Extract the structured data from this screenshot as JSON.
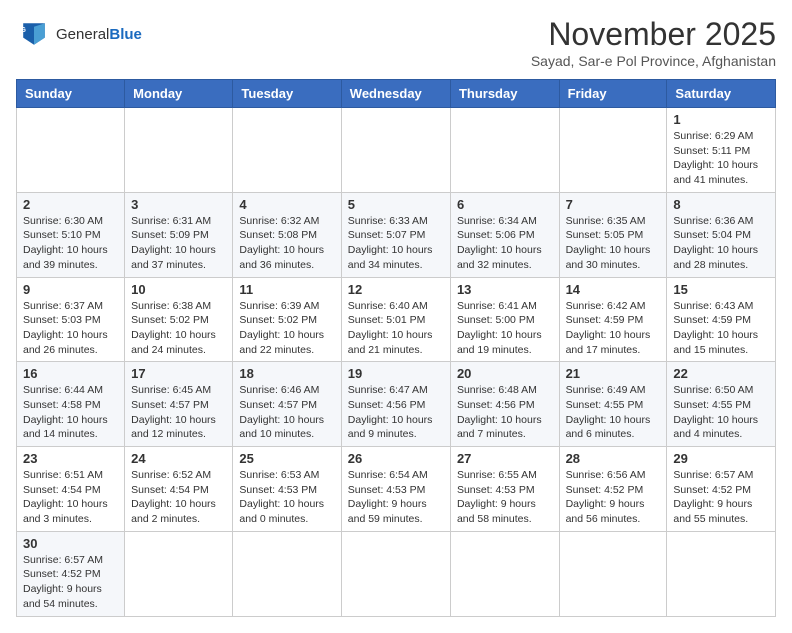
{
  "header": {
    "logo_text_general": "General",
    "logo_text_blue": "Blue",
    "month_title": "November 2025",
    "subtitle": "Sayad, Sar-e Pol Province, Afghanistan"
  },
  "days_of_week": [
    "Sunday",
    "Monday",
    "Tuesday",
    "Wednesday",
    "Thursday",
    "Friday",
    "Saturday"
  ],
  "weeks": [
    [
      {
        "num": "",
        "info": ""
      },
      {
        "num": "",
        "info": ""
      },
      {
        "num": "",
        "info": ""
      },
      {
        "num": "",
        "info": ""
      },
      {
        "num": "",
        "info": ""
      },
      {
        "num": "",
        "info": ""
      },
      {
        "num": "1",
        "info": "Sunrise: 6:29 AM\nSunset: 5:11 PM\nDaylight: 10 hours and 41 minutes."
      }
    ],
    [
      {
        "num": "2",
        "info": "Sunrise: 6:30 AM\nSunset: 5:10 PM\nDaylight: 10 hours and 39 minutes."
      },
      {
        "num": "3",
        "info": "Sunrise: 6:31 AM\nSunset: 5:09 PM\nDaylight: 10 hours and 37 minutes."
      },
      {
        "num": "4",
        "info": "Sunrise: 6:32 AM\nSunset: 5:08 PM\nDaylight: 10 hours and 36 minutes."
      },
      {
        "num": "5",
        "info": "Sunrise: 6:33 AM\nSunset: 5:07 PM\nDaylight: 10 hours and 34 minutes."
      },
      {
        "num": "6",
        "info": "Sunrise: 6:34 AM\nSunset: 5:06 PM\nDaylight: 10 hours and 32 minutes."
      },
      {
        "num": "7",
        "info": "Sunrise: 6:35 AM\nSunset: 5:05 PM\nDaylight: 10 hours and 30 minutes."
      },
      {
        "num": "8",
        "info": "Sunrise: 6:36 AM\nSunset: 5:04 PM\nDaylight: 10 hours and 28 minutes."
      }
    ],
    [
      {
        "num": "9",
        "info": "Sunrise: 6:37 AM\nSunset: 5:03 PM\nDaylight: 10 hours and 26 minutes."
      },
      {
        "num": "10",
        "info": "Sunrise: 6:38 AM\nSunset: 5:02 PM\nDaylight: 10 hours and 24 minutes."
      },
      {
        "num": "11",
        "info": "Sunrise: 6:39 AM\nSunset: 5:02 PM\nDaylight: 10 hours and 22 minutes."
      },
      {
        "num": "12",
        "info": "Sunrise: 6:40 AM\nSunset: 5:01 PM\nDaylight: 10 hours and 21 minutes."
      },
      {
        "num": "13",
        "info": "Sunrise: 6:41 AM\nSunset: 5:00 PM\nDaylight: 10 hours and 19 minutes."
      },
      {
        "num": "14",
        "info": "Sunrise: 6:42 AM\nSunset: 4:59 PM\nDaylight: 10 hours and 17 minutes."
      },
      {
        "num": "15",
        "info": "Sunrise: 6:43 AM\nSunset: 4:59 PM\nDaylight: 10 hours and 15 minutes."
      }
    ],
    [
      {
        "num": "16",
        "info": "Sunrise: 6:44 AM\nSunset: 4:58 PM\nDaylight: 10 hours and 14 minutes."
      },
      {
        "num": "17",
        "info": "Sunrise: 6:45 AM\nSunset: 4:57 PM\nDaylight: 10 hours and 12 minutes."
      },
      {
        "num": "18",
        "info": "Sunrise: 6:46 AM\nSunset: 4:57 PM\nDaylight: 10 hours and 10 minutes."
      },
      {
        "num": "19",
        "info": "Sunrise: 6:47 AM\nSunset: 4:56 PM\nDaylight: 10 hours and 9 minutes."
      },
      {
        "num": "20",
        "info": "Sunrise: 6:48 AM\nSunset: 4:56 PM\nDaylight: 10 hours and 7 minutes."
      },
      {
        "num": "21",
        "info": "Sunrise: 6:49 AM\nSunset: 4:55 PM\nDaylight: 10 hours and 6 minutes."
      },
      {
        "num": "22",
        "info": "Sunrise: 6:50 AM\nSunset: 4:55 PM\nDaylight: 10 hours and 4 minutes."
      }
    ],
    [
      {
        "num": "23",
        "info": "Sunrise: 6:51 AM\nSunset: 4:54 PM\nDaylight: 10 hours and 3 minutes."
      },
      {
        "num": "24",
        "info": "Sunrise: 6:52 AM\nSunset: 4:54 PM\nDaylight: 10 hours and 2 minutes."
      },
      {
        "num": "25",
        "info": "Sunrise: 6:53 AM\nSunset: 4:53 PM\nDaylight: 10 hours and 0 minutes."
      },
      {
        "num": "26",
        "info": "Sunrise: 6:54 AM\nSunset: 4:53 PM\nDaylight: 9 hours and 59 minutes."
      },
      {
        "num": "27",
        "info": "Sunrise: 6:55 AM\nSunset: 4:53 PM\nDaylight: 9 hours and 58 minutes."
      },
      {
        "num": "28",
        "info": "Sunrise: 6:56 AM\nSunset: 4:52 PM\nDaylight: 9 hours and 56 minutes."
      },
      {
        "num": "29",
        "info": "Sunrise: 6:57 AM\nSunset: 4:52 PM\nDaylight: 9 hours and 55 minutes."
      }
    ],
    [
      {
        "num": "30",
        "info": "Sunrise: 6:57 AM\nSunset: 4:52 PM\nDaylight: 9 hours and 54 minutes."
      },
      {
        "num": "",
        "info": ""
      },
      {
        "num": "",
        "info": ""
      },
      {
        "num": "",
        "info": ""
      },
      {
        "num": "",
        "info": ""
      },
      {
        "num": "",
        "info": ""
      },
      {
        "num": "",
        "info": ""
      }
    ]
  ]
}
